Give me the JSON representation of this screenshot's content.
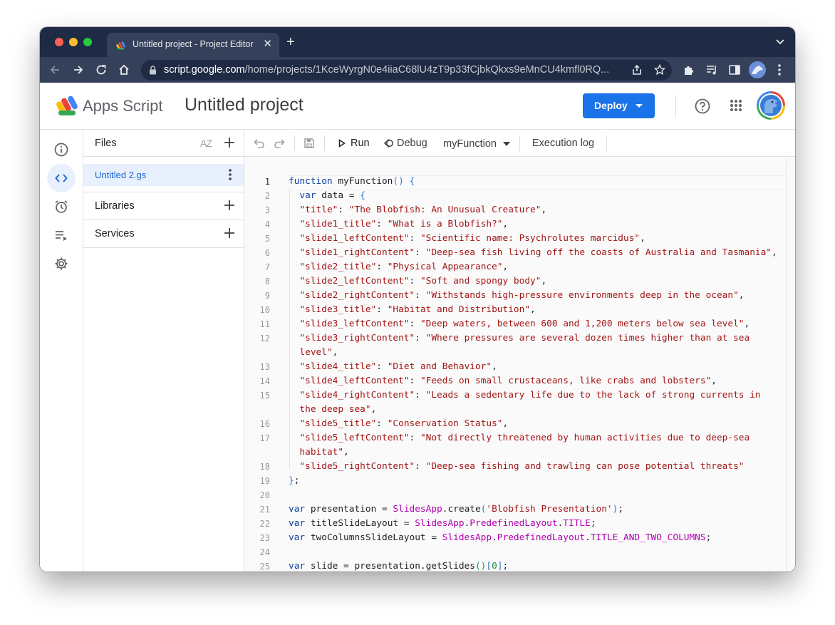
{
  "browser": {
    "tab_title": "Untitled project - Project Editor",
    "url_host": "script.google.com",
    "url_path": "/home/projects/1KceWyrgN0e4iiaC68lU4zT9p33fCjbkQkxs9eMnCU4kmfl0RQ..."
  },
  "header": {
    "brand": "Apps Script",
    "project_name": "Untitled project",
    "deploy_label": "Deploy"
  },
  "files_panel": {
    "title": "Files",
    "sort_label": "AZ",
    "files": [
      {
        "name": "Untitled 2.gs"
      }
    ],
    "libraries_label": "Libraries",
    "services_label": "Services"
  },
  "editor_toolbar": {
    "run_label": "Run",
    "debug_label": "Debug",
    "function_select": "myFunction",
    "execution_log_label": "Execution log"
  },
  "code": {
    "current_line": 1,
    "lines": [
      {
        "n": "1",
        "t": [
          [
            "function ",
            "kw"
          ],
          [
            "myFunction",
            ""
          ],
          [
            "() {",
            "br"
          ]
        ]
      },
      {
        "n": "2",
        "t": [
          [
            "  ",
            ""
          ],
          [
            "var ",
            "kw"
          ],
          [
            "data = ",
            ""
          ],
          [
            "{",
            "br"
          ]
        ]
      },
      {
        "n": "3",
        "t": [
          [
            "  ",
            ""
          ],
          [
            "\"title\"",
            "str"
          ],
          [
            ": ",
            ""
          ],
          [
            "\"The Blobfish: An Unusual Creature\"",
            "str"
          ],
          [
            ",",
            ""
          ]
        ]
      },
      {
        "n": "4",
        "t": [
          [
            "  ",
            ""
          ],
          [
            "\"slide1_title\"",
            "str"
          ],
          [
            ": ",
            ""
          ],
          [
            "\"What is a Blobfish?\"",
            "str"
          ],
          [
            ",",
            ""
          ]
        ]
      },
      {
        "n": "5",
        "t": [
          [
            "  ",
            ""
          ],
          [
            "\"slide1_leftContent\"",
            "str"
          ],
          [
            ": ",
            ""
          ],
          [
            "\"Scientific name: Psychrolutes marcidus\"",
            "str"
          ],
          [
            ",",
            ""
          ]
        ]
      },
      {
        "n": "6",
        "t": [
          [
            "  ",
            ""
          ],
          [
            "\"slide1_rightContent\"",
            "str"
          ],
          [
            ": ",
            ""
          ],
          [
            "\"Deep-sea fish living off the coasts of Australia and Tasmania\"",
            "str"
          ],
          [
            ",",
            ""
          ]
        ]
      },
      {
        "n": "7",
        "t": [
          [
            "  ",
            ""
          ],
          [
            "\"slide2_title\"",
            "str"
          ],
          [
            ": ",
            ""
          ],
          [
            "\"Physical Appearance\"",
            "str"
          ],
          [
            ",",
            ""
          ]
        ]
      },
      {
        "n": "8",
        "t": [
          [
            "  ",
            ""
          ],
          [
            "\"slide2_leftContent\"",
            "str"
          ],
          [
            ": ",
            ""
          ],
          [
            "\"Soft and spongy body\"",
            "str"
          ],
          [
            ",",
            ""
          ]
        ]
      },
      {
        "n": "9",
        "t": [
          [
            "  ",
            ""
          ],
          [
            "\"slide2_rightContent\"",
            "str"
          ],
          [
            ": ",
            ""
          ],
          [
            "\"Withstands high-pressure environments deep in the ocean\"",
            "str"
          ],
          [
            ",",
            ""
          ]
        ]
      },
      {
        "n": "10",
        "t": [
          [
            "  ",
            ""
          ],
          [
            "\"slide3_title\"",
            "str"
          ],
          [
            ": ",
            ""
          ],
          [
            "\"Habitat and Distribution\"",
            "str"
          ],
          [
            ",",
            ""
          ]
        ]
      },
      {
        "n": "11",
        "t": [
          [
            "  ",
            ""
          ],
          [
            "\"slide3_leftContent\"",
            "str"
          ],
          [
            ": ",
            ""
          ],
          [
            "\"Deep waters, between 600 and 1,200 meters below sea level\"",
            "str"
          ],
          [
            ",",
            ""
          ]
        ]
      },
      {
        "n": "12",
        "t": [
          [
            "  ",
            ""
          ],
          [
            "\"slide3_rightContent\"",
            "str"
          ],
          [
            ": ",
            ""
          ],
          [
            "\"Where pressures are several dozen times higher than at sea",
            "str"
          ]
        ]
      },
      {
        "n": "",
        "t": [
          [
            "  ",
            ""
          ],
          [
            "level\"",
            "str"
          ],
          [
            ",",
            ""
          ]
        ]
      },
      {
        "n": "13",
        "t": [
          [
            "  ",
            ""
          ],
          [
            "\"slide4_title\"",
            "str"
          ],
          [
            ": ",
            ""
          ],
          [
            "\"Diet and Behavior\"",
            "str"
          ],
          [
            ",",
            ""
          ]
        ]
      },
      {
        "n": "14",
        "t": [
          [
            "  ",
            ""
          ],
          [
            "\"slide4_leftContent\"",
            "str"
          ],
          [
            ": ",
            ""
          ],
          [
            "\"Feeds on small crustaceans, like crabs and lobsters\"",
            "str"
          ],
          [
            ",",
            ""
          ]
        ]
      },
      {
        "n": "15",
        "t": [
          [
            "  ",
            ""
          ],
          [
            "\"slide4_rightContent\"",
            "str"
          ],
          [
            ": ",
            ""
          ],
          [
            "\"Leads a sedentary life due to the lack of strong currents in",
            "str"
          ]
        ]
      },
      {
        "n": "",
        "t": [
          [
            "  ",
            ""
          ],
          [
            "the deep sea\"",
            "str"
          ],
          [
            ",",
            ""
          ]
        ]
      },
      {
        "n": "16",
        "t": [
          [
            "  ",
            ""
          ],
          [
            "\"slide5_title\"",
            "str"
          ],
          [
            ": ",
            ""
          ],
          [
            "\"Conservation Status\"",
            "str"
          ],
          [
            ",",
            ""
          ]
        ]
      },
      {
        "n": "17",
        "t": [
          [
            "  ",
            ""
          ],
          [
            "\"slide5_leftContent\"",
            "str"
          ],
          [
            ": ",
            ""
          ],
          [
            "\"Not directly threatened by human activities due to deep-sea",
            "str"
          ]
        ]
      },
      {
        "n": "",
        "t": [
          [
            "  ",
            ""
          ],
          [
            "habitat\"",
            "str"
          ],
          [
            ",",
            ""
          ]
        ]
      },
      {
        "n": "18",
        "t": [
          [
            "  ",
            ""
          ],
          [
            "\"slide5_rightContent\"",
            "str"
          ],
          [
            ": ",
            ""
          ],
          [
            "\"Deep-sea fishing and trawling can pose potential threats\"",
            "str"
          ]
        ]
      },
      {
        "n": "19",
        "t": [
          [
            "}",
            "br"
          ],
          [
            ";",
            ""
          ]
        ]
      },
      {
        "n": "20",
        "t": []
      },
      {
        "n": "21",
        "t": [
          [
            "var ",
            "kw"
          ],
          [
            "presentation = ",
            ""
          ],
          [
            "SlidesApp",
            "cls"
          ],
          [
            ".create",
            ""
          ],
          [
            "(",
            "br"
          ],
          [
            "'Blobfish Presentation'",
            "str"
          ],
          [
            ")",
            "br"
          ],
          [
            ";",
            ""
          ]
        ]
      },
      {
        "n": "22",
        "t": [
          [
            "var ",
            "kw"
          ],
          [
            "titleSlideLayout = ",
            ""
          ],
          [
            "SlidesApp",
            "cls"
          ],
          [
            ".",
            ""
          ],
          [
            "PredefinedLayout",
            "cls"
          ],
          [
            ".",
            ""
          ],
          [
            "TITLE",
            "cls"
          ],
          [
            ";",
            ""
          ]
        ]
      },
      {
        "n": "23",
        "t": [
          [
            "var ",
            "kw"
          ],
          [
            "twoColumnsSlideLayout = ",
            ""
          ],
          [
            "SlidesApp",
            "cls"
          ],
          [
            ".",
            ""
          ],
          [
            "PredefinedLayout",
            "cls"
          ],
          [
            ".",
            ""
          ],
          [
            "TITLE_AND_TWO_COLUMNS",
            "cls"
          ],
          [
            ";",
            ""
          ]
        ]
      },
      {
        "n": "24",
        "t": []
      },
      {
        "n": "25",
        "t": [
          [
            "var ",
            "kw"
          ],
          [
            "slide = presentation.getSlides",
            ""
          ],
          [
            "()",
            "gr"
          ],
          [
            "[",
            "br"
          ],
          [
            "0",
            "gr"
          ],
          [
            "]",
            "br"
          ],
          [
            ";",
            ""
          ]
        ]
      }
    ]
  },
  "colors": {
    "accent": "#1a73e8",
    "keyword": "#0b3da1",
    "string": "#a31515",
    "class": "#b000b0"
  }
}
